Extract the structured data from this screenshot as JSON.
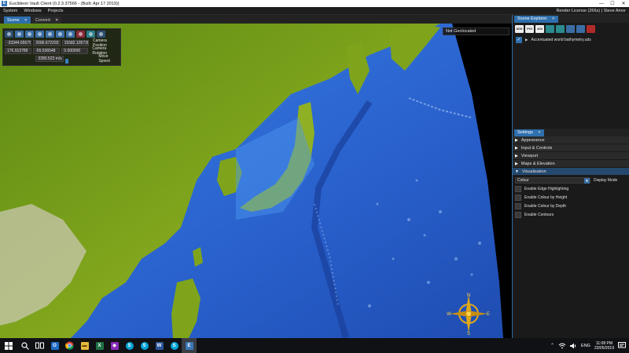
{
  "window": {
    "title": "Euclideon Vault Client (0.2.3.37566 - (Built: Apr 17 2019))",
    "minimize": "—",
    "maximize": "☐",
    "close": "✕"
  },
  "menu": {
    "items": [
      "System",
      "Windows",
      "Projects"
    ],
    "license": "Render License (266s) | Steve Amor"
  },
  "tabs": [
    {
      "label": "Scene",
      "active": true
    },
    {
      "label": "Convert",
      "active": false
    }
  ],
  "camera": {
    "position": [
      "-33344.655750",
      "2096.672293",
      "15582.105730"
    ],
    "position_label": "Camera Position",
    "rotation": [
      "176.913789",
      "-55.536548",
      "0.000000"
    ],
    "rotation_label": "Camera Rotation",
    "speed": "3280.523 m/s",
    "speed_label": "Move Speed"
  },
  "geolocation": "Not Geolocated",
  "scene_explorer": {
    "tab": "Scene Explorer",
    "tools": [
      "UDS",
      "POI",
      "AOI",
      "",
      "",
      "",
      "",
      ""
    ],
    "items": [
      {
        "name": "Accentuated world bathymetry.uds",
        "checked": true
      }
    ]
  },
  "settings": {
    "tab": "Settings",
    "sections": [
      "Appearance",
      "Input & Controls",
      "Viewport",
      "Maps & Elevation",
      "Visualisation"
    ],
    "display_mode": {
      "value": "Colour",
      "label": "Display Mode"
    },
    "options": [
      "Enable Edge Highlighting",
      "Enable Colour by Height",
      "Enable Colour by Depth",
      "Enable Contours"
    ]
  },
  "compass": {
    "n": "N",
    "e": "E",
    "s": "S",
    "w": "W"
  },
  "taskbar": {
    "language": "ENG",
    "time": "11:08 PM",
    "date": "23/05/2019",
    "icons": [
      "search-icon",
      "task-view-icon",
      "outlook-icon",
      "chrome-icon",
      "file-explorer-icon",
      "excel-icon",
      "visual-studio-icon",
      "skype-icon",
      "skype-icon-2",
      "word-icon",
      "skype-icon-3",
      "vault-client-icon"
    ]
  },
  "colors": {
    "accent": "#2e6fae",
    "ocean": "#2f6fd8",
    "deep_ocean": "#1f4fb8",
    "land": "#6f9a18",
    "compass": "#e0a818"
  }
}
